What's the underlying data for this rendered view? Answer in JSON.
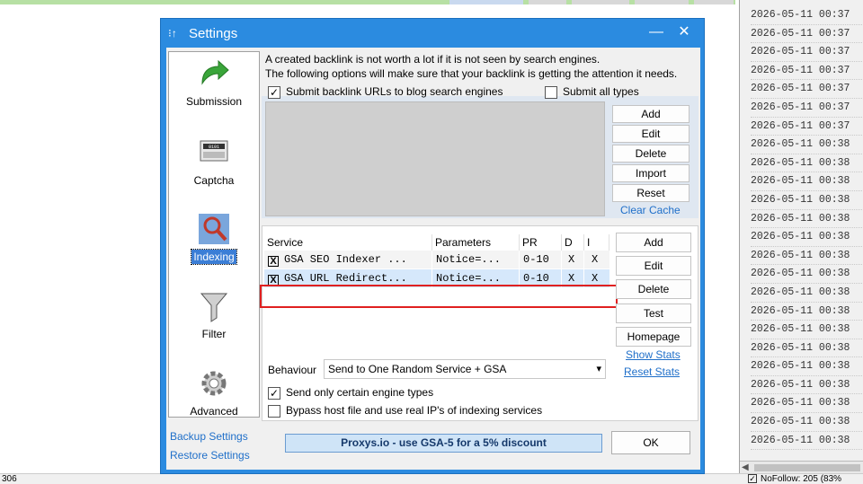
{
  "background": {
    "log_lines": [
      "2026-05-11 00:37",
      "2026-05-11 00:37",
      "2026-05-11 00:37",
      "2026-05-11 00:37",
      "2026-05-11 00:37",
      "2026-05-11 00:37",
      "2026-05-11 00:37",
      "2026-05-11 00:38",
      "2026-05-11 00:38",
      "2026-05-11 00:38",
      "2026-05-11 00:38",
      "2026-05-11 00:38",
      "2026-05-11 00:38",
      "2026-05-11 00:38",
      "2026-05-11 00:38",
      "2026-05-11 00:38",
      "2026-05-11 00:38",
      "2026-05-11 00:38",
      "2026-05-11 00:38",
      "2026-05-11 00:38",
      "2026-05-11 00:38",
      "2026-05-11 00:38",
      "2026-05-11 00:38",
      "2026-05-11 00:38"
    ],
    "status_left": "306",
    "status_right": "NoFollow: 205 (83%"
  },
  "dialog": {
    "title": "Settings",
    "minimize": "—",
    "close": "✕"
  },
  "nav": {
    "items": [
      {
        "label": "Submission",
        "icon": "green-arrow-icon"
      },
      {
        "label": "Captcha",
        "icon": "captcha-icon"
      },
      {
        "label": "Indexing",
        "icon": "indexing-icon",
        "selected": true
      },
      {
        "label": "Filter",
        "icon": "funnel-icon"
      },
      {
        "label": "Advanced",
        "icon": "gear-icon"
      }
    ],
    "backup": "Backup Settings",
    "restore": "Restore Settings"
  },
  "indexing": {
    "desc1": "A created backlink is not worth a lot if it is not seen by search engines.",
    "desc2": "The following options will make sure that your backlink is getting the attention it needs.",
    "submit_blog": {
      "label": "Submit backlink URLs to blog search engines",
      "checked": true
    },
    "submit_all": {
      "label": "Submit all types",
      "checked": false
    },
    "list_buttons": [
      "Add",
      "Edit",
      "Delete",
      "Import",
      "Reset"
    ],
    "clear_cache": "Clear Cache",
    "services": {
      "headers": [
        "Service",
        "Parameters",
        "PR",
        "D",
        "I"
      ],
      "rows": [
        {
          "checked": "X",
          "service": "GSA SEO Indexer ...",
          "params": "Notice=...",
          "pr": "0-10",
          "d": "X",
          "i": "X"
        },
        {
          "checked": "X",
          "service": "GSA URL Redirect...",
          "params": "Notice=...",
          "pr": "0-10",
          "d": "X",
          "i": "X"
        }
      ],
      "buttons": [
        "Add",
        "Edit",
        "Delete",
        "Test",
        "Homepage"
      ],
      "show_stats": "Show Stats",
      "reset_stats": "Reset Stats"
    },
    "behaviour_label": "Behaviour",
    "behaviour_value": "Send to One Random Service + GSA",
    "send_only": {
      "label": "Send only certain engine types",
      "checked": true
    },
    "bypass_host": {
      "label": "Bypass host file and use real IP's of indexing services",
      "checked": false
    },
    "proxy_banner": "Proxys.io - use GSA-5 for a 5% discount",
    "ok": "OK"
  }
}
